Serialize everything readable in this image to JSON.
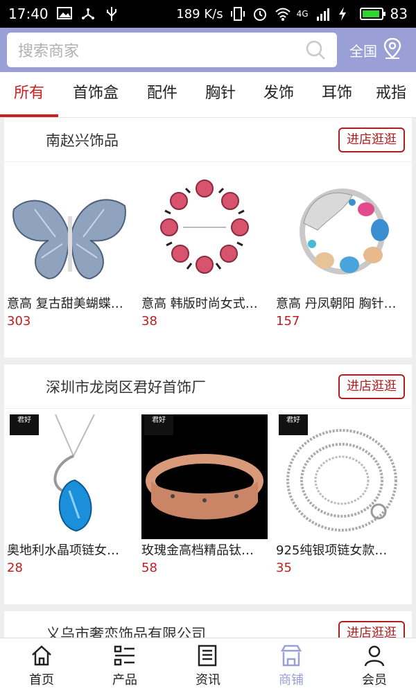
{
  "status_bar": {
    "time": "17:40",
    "speed": "189 K/s",
    "signal": "4G",
    "battery": "83"
  },
  "search": {
    "placeholder": "搜索商家",
    "region": "全国"
  },
  "tabs": [
    "所有",
    "首饰盒",
    "配件",
    "胸针",
    "发饰",
    "耳饰",
    "戒指"
  ],
  "shops": [
    {
      "name": "南赵兴饰品",
      "enter_label": "进店逛逛",
      "products": [
        {
          "name": "意高 复古甜美蝴蝶…",
          "price": "303"
        },
        {
          "name": "意高 韩版时尚女式…",
          "price": "38"
        },
        {
          "name": "意高 丹凤朝阳 胸针…",
          "price": "157"
        }
      ]
    },
    {
      "name": "深圳市龙岗区君好首饰厂",
      "enter_label": "进店逛逛",
      "products": [
        {
          "name": "奥地利水晶项链女…",
          "price": "28",
          "badge": "君好"
        },
        {
          "name": "玫瑰金高档精品钛…",
          "price": "58",
          "badge": "君好"
        },
        {
          "name": "925纯银项链女款…",
          "price": "35",
          "badge": "君好"
        }
      ]
    },
    {
      "name": "义乌市奢恋饰品有限公司",
      "enter_label": "进店逛逛"
    }
  ],
  "bottom_nav": [
    "首页",
    "产品",
    "资讯",
    "商铺",
    "会员"
  ],
  "colors": {
    "header": "#9a9fd6",
    "accent": "#cc1f1f",
    "price": "#c41c1c"
  }
}
